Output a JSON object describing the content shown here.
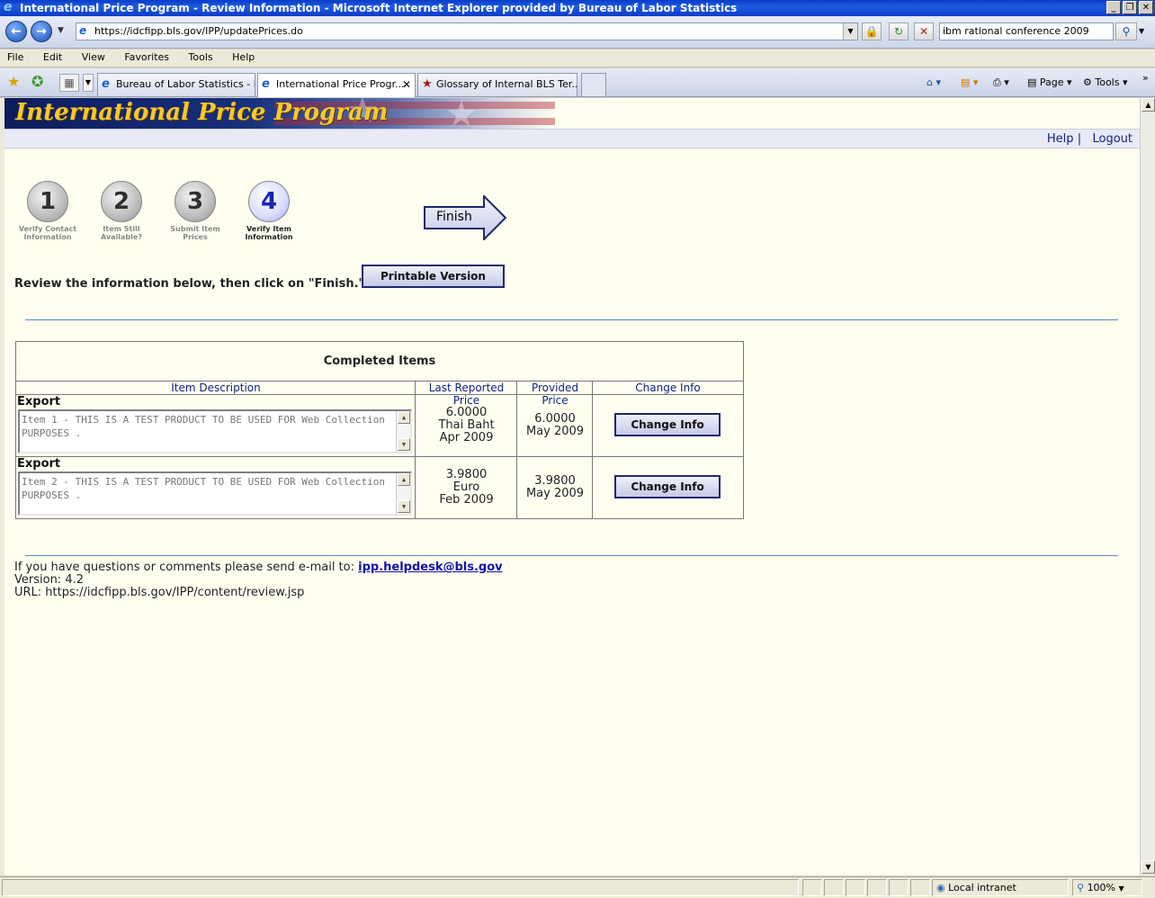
{
  "window": {
    "title": "International Price Program - Review Information - Microsoft Internet Explorer provided by Bureau of Labor Statistics",
    "buttons": [
      "_",
      "❐",
      "✕"
    ]
  },
  "browser": {
    "url": "https://idcfipp.bls.gov/IPP/updatePrices.do",
    "search_value": "ibm rational conference 2009",
    "menu": [
      "File",
      "Edit",
      "View",
      "Favorites",
      "Tools",
      "Help"
    ],
    "tabs": [
      {
        "label": "Bureau of Labor Statistics - I...",
        "active": false
      },
      {
        "label": "International Price Progr...",
        "active": true
      },
      {
        "label": "Glossary of Internal BLS Ter...",
        "active": false
      }
    ],
    "command_bar": {
      "page_label": "Page",
      "tools_label": "Tools"
    },
    "status": {
      "zone": "Local intranet",
      "zoom": "100%"
    }
  },
  "page": {
    "banner_title": "International Price Program",
    "links": {
      "help": "Help",
      "separator": "|",
      "logout": "Logout"
    },
    "steps": [
      {
        "number": "1",
        "label_line1": "Verify Contact",
        "label_line2": "Information"
      },
      {
        "number": "2",
        "label_line1": "Item Still",
        "label_line2": "Available?"
      },
      {
        "number": "3",
        "label_line1": "Submit Item",
        "label_line2": "Prices"
      },
      {
        "number": "4",
        "label_line1": "Verify Item",
        "label_line2": "Information"
      }
    ],
    "finish_label": "Finish",
    "printable_label": "Printable Version",
    "instruction": "Review the information below, then click on \"Finish.\"",
    "table": {
      "caption": "Completed Items",
      "headers": [
        "Item Description",
        "Last Reported Price",
        "Provided Price",
        "Change Info"
      ],
      "rows": [
        {
          "type": "Export",
          "description": "Item 1 - THIS IS A TEST PRODUCT TO BE USED FOR Web Collection PURPOSES .",
          "last_price": "6.0000",
          "last_currency": "Thai Baht",
          "last_date": "Apr 2009",
          "provided_price": "6.0000",
          "provided_date": "May 2009",
          "button": "Change Info"
        },
        {
          "type": "Export",
          "description": "Item 2  - THIS IS A TEST PRODUCT TO BE USED FOR Web Collection PURPOSES .",
          "last_price": "3.9800",
          "last_currency": "Euro",
          "last_date": "Feb 2009",
          "provided_price": "3.9800",
          "provided_date": "May 2009",
          "button": "Change Info"
        }
      ]
    },
    "footer": {
      "contact_text": "If you have questions or comments please send e-mail to:",
      "email": "ipp.helpdesk@bls.gov",
      "version": "Version: 4.2",
      "url": "URL: https://idcfipp.bls.gov/IPP/content/review.jsp"
    }
  }
}
